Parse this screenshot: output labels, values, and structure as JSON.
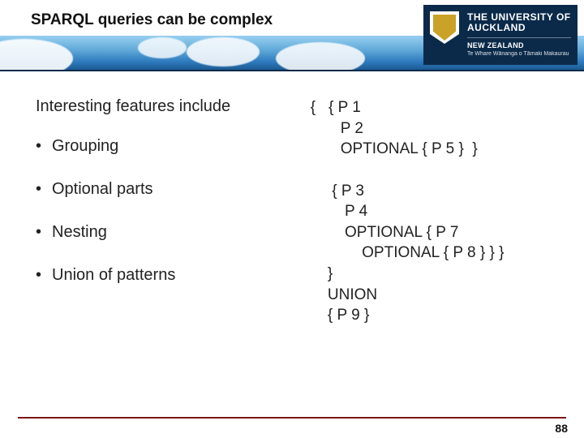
{
  "header": {
    "title": "SPARQL queries can be complex",
    "logo": {
      "university": "THE UNIVERSITY OF",
      "university2": "AUCKLAND",
      "country": "NEW ZEALAND",
      "maori": "Te Whare Wānanga o Tāmaki Makaurau"
    }
  },
  "left": {
    "intro": "Interesting features include",
    "items": [
      "Grouping",
      "Optional parts",
      "Nesting",
      "Union of patterns"
    ]
  },
  "code": {
    "line1": "{   { P 1",
    "line2": "       P 2",
    "line3": "       OPTIONAL { P 5 }  }",
    "line4": "",
    "line5": "     { P 3",
    "line6": "        P 4",
    "line7": "        OPTIONAL { P 7",
    "line8": "            OPTIONAL { P 8 } } }",
    "line9": "    }",
    "line10": "    UNION",
    "line11": "    { P 9 }"
  },
  "footer": {
    "page": "88"
  }
}
